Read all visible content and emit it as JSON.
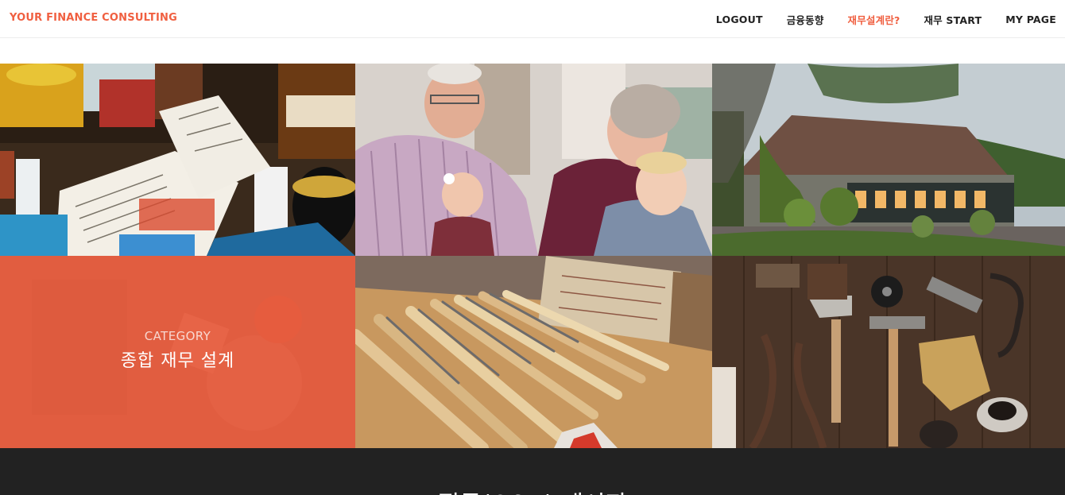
{
  "brand": {
    "label": "YOUR FINANCE CONSULTING",
    "color": "#f05f40"
  },
  "nav": {
    "items": [
      {
        "label": "LOGOUT",
        "active": false
      },
      {
        "label": "금융동향",
        "active": false
      },
      {
        "label": "재무설계란?",
        "active": true
      },
      {
        "label": "재무 START",
        "active": false
      },
      {
        "label": "MY PAGE",
        "active": false
      }
    ]
  },
  "portfolio": {
    "tiles": [
      {
        "image": "receipt-and-groceries-photo"
      },
      {
        "image": "grandparents-with-children-photo"
      },
      {
        "image": "country-house-photo"
      },
      {
        "image": "desk-with-overlay-photo",
        "category_label": "CATEGORY",
        "category_name": "종합 재무 설계"
      },
      {
        "image": "rulers-and-codfish-box-photo"
      },
      {
        "image": "hand-tools-on-wood-photo"
      }
    ],
    "overlay_color": "#f05f40"
  },
  "section": {
    "heading": "질문(Q&A) 게시판"
  },
  "colors": {
    "accent": "#f05f40",
    "dark": "#222222"
  }
}
